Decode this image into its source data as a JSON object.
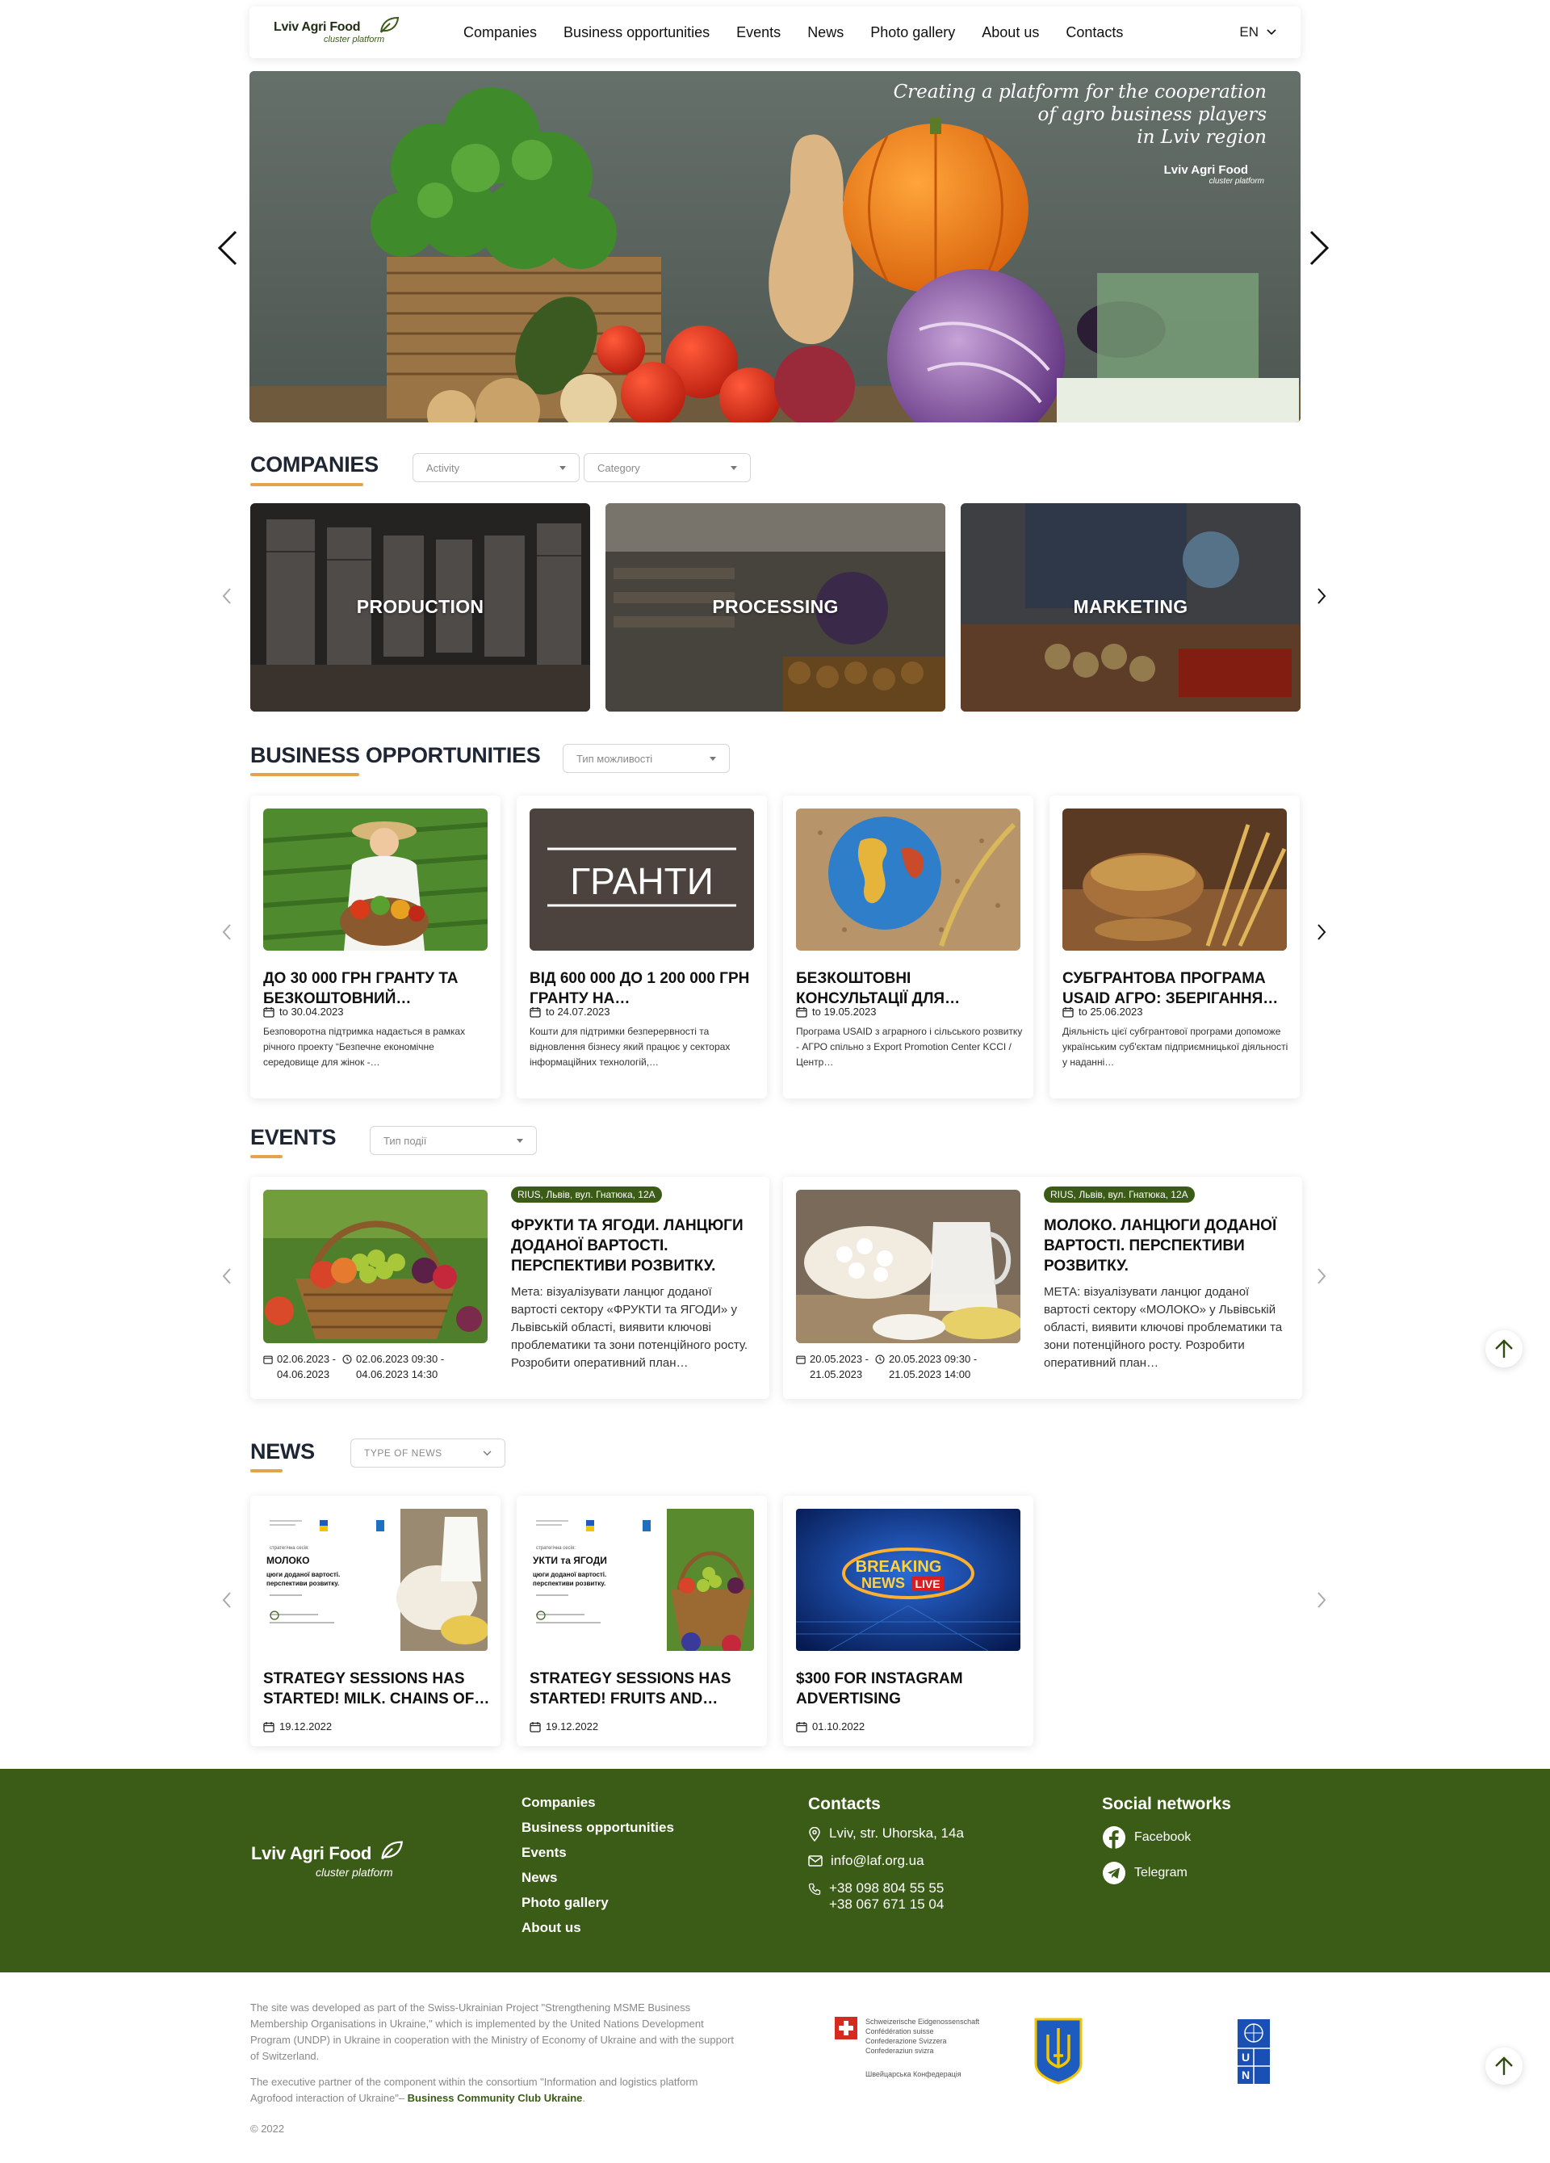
{
  "header": {
    "logo_main": "Lviv Agri Food",
    "logo_sub": "cluster platform",
    "nav": [
      "Companies",
      "Business opportunities",
      "Events",
      "News",
      "Photo gallery",
      "About us",
      "Contacts"
    ],
    "language": "EN"
  },
  "hero": {
    "line1": "Creating a platform for the cooperation",
    "line2": "of agro business players",
    "line3": "in Lviv region",
    "logo_main": "Lviv Agri Food",
    "logo_sub": "cluster platform"
  },
  "companies": {
    "title": "COMPANIES",
    "filter_activity": "Activity",
    "filter_category": "Category",
    "cards": [
      "PRODUCTION",
      "PROCESSING",
      "MARKETING"
    ]
  },
  "business": {
    "title": "BUSINESS OPPORTUNITIES",
    "filter": "Тип можливості",
    "cards": [
      {
        "title": "ДО 30 000 ГРН ГРАНТУ ТА БЕЗКОШТОВНИЙ…",
        "date": "to 30.04.2023",
        "desc": "Безповоротна підтримка надається в рамках річного проекту “Безпечне економічне середовище для жінок -…"
      },
      {
        "title": "ВІД 600 000 ДО 1 200 000 ГРН ГРАНТУ НА…",
        "date": "to 24.07.2023",
        "desc": "Кошти для підтримки безперервності та відновлення бізнесу який працює у секторах інформаційних технологій,…",
        "img_text": "ГРАНТИ"
      },
      {
        "title": "БЕЗКОШТОВНІ КОНСУЛЬТАЦІЇ ДЛЯ…",
        "date": "to 19.05.2023",
        "desc": "Програма USAID з аграрного і сільського розвитку - АГРО спільно з Export Promotion Center KCCI / Центр…"
      },
      {
        "title": "СУБГРАНТОВА ПРОГРАМА USAID АГРО: ЗБЕРІГАННЯ…",
        "date": "to 25.06.2023",
        "desc": "Діяльність цієї субгрантової програми допоможе українським суб'єктам підприємницької діяльності у наданні…"
      }
    ]
  },
  "events": {
    "title": "EVENTS",
    "filter": "Тип події",
    "cards": [
      {
        "badge": "RIUS, Львів, вул. Гнатюка, 12А",
        "title": "ФРУКТИ ТА ЯГОДИ. ЛАНЦЮГИ ДОДАНОЇ ВАРТОСТІ. ПЕРСПЕКТИВИ РОЗВИТКУ.",
        "desc": "Мета: візуалізувати ланцюг доданої вартості сектору «ФРУКТИ та ЯГОДИ» у Львівській області, виявити ключові проблематики та зони потенційного росту. Розробити оперативний план…",
        "date1": "02.06.2023 -",
        "date2": "04.06.2023",
        "time1": "02.06.2023 09:30 -",
        "time2": "04.06.2023 14:30"
      },
      {
        "badge": "RIUS, Львів, вул. Гнатюка, 12А",
        "title": "МОЛОКО. ЛАНЦЮГИ ДОДАНОЇ ВАРТОСТІ. ПЕРСПЕКТИВИ РОЗВИТКУ.",
        "desc": "МЕТА: візуалізувати ланцюг доданої вартості сектору «МОЛОКО» у Львівській області, виявити ключові проблематики та зони потенційного росту. Розробити оперативний план…",
        "date1": "20.05.2023 -",
        "date2": "21.05.2023",
        "time1": "20.05.2023 09:30 -",
        "time2": "21.05.2023 14:00"
      }
    ]
  },
  "news": {
    "title": "NEWS",
    "filter": "TYPE OF NEWS",
    "cards": [
      {
        "title": "STRATEGY SESSIONS HAS STARTED! MILK. CHAINS OF…",
        "date": "19.12.2022",
        "img_line1": "стратегічна сесія:",
        "img_line2": "МОЛОКО",
        "img_line3": "цюги доданої вартості.",
        "img_line4": "перспективи розвитку."
      },
      {
        "title": "STRATEGY SESSIONS HAS STARTED! FRUITS AND…",
        "date": "19.12.2022",
        "img_line1": "стратегічна сесія:",
        "img_line2": "УКТИ та ЯГОДИ",
        "img_line3": "цюги доданої вартості.",
        "img_line4": "перспективи розвитку."
      },
      {
        "title": "$300 FOR INSTAGRAM ADVERTISING",
        "date": "01.10.2022",
        "img_line1": "BREAKING",
        "img_line2": "NEWS",
        "img_line3": "LIVE"
      }
    ]
  },
  "footer": {
    "logo_main": "Lviv Agri Food",
    "logo_sub": "cluster platform",
    "links": [
      "Companies",
      "Business opportunities",
      "Events",
      "News",
      "Photo gallery",
      "About us"
    ],
    "contacts_title": "Contacts",
    "address": "Lviv, str. Uhorska, 14a",
    "email": "info@laf.org.ua",
    "phone1": "+38 098 804 55 55",
    "phone2": "+38 067 671 15 04",
    "social_title": "Social networks",
    "facebook": "Facebook",
    "telegram": "Telegram"
  },
  "bottom": {
    "para1": "The site was developed as part of the Swiss-Ukrainian Project \"Strengthening MSME Business Membership Organisations in Ukraine,\" which is implemented by the United Nations Development Program (UNDP) in Ukraine in cooperation with the Ministry of Economy of Ukraine and with the support of Switzerland.",
    "para2_start": "The executive partner of the component within the consortium \"Information and logistics platform Agrofood interaction of Ukraine\"– ",
    "para2_link": "Business Community Club Ukraine",
    "para2_end": ".",
    "copyright": "© 2022",
    "swiss_line1": "Schweizerische Eidgenossenschaft",
    "swiss_line2": "Confédération suisse",
    "swiss_line3": "Confederazione Svizzera",
    "swiss_line4": "Confederaziun svizra",
    "swiss_line5": "Швейцарська Конфедерація",
    "undp": "U N D P"
  }
}
